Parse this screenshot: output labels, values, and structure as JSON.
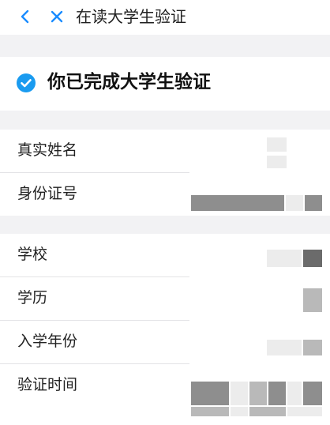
{
  "header": {
    "title": "在读大学生验证",
    "back_icon": "chevron-left-icon",
    "close_icon": "close-icon",
    "icon_color": "#1a8cff"
  },
  "status": {
    "text": "你已完成大学生验证",
    "icon": "check-circle-icon",
    "icon_color": "#1a9bf0"
  },
  "personal": {
    "rows": [
      {
        "label": "真实姓名"
      },
      {
        "label": "身份证号"
      }
    ]
  },
  "education": {
    "rows": [
      {
        "label": "学校"
      },
      {
        "label": "学历"
      },
      {
        "label": "入学年份"
      },
      {
        "label": "验证时间"
      }
    ]
  }
}
